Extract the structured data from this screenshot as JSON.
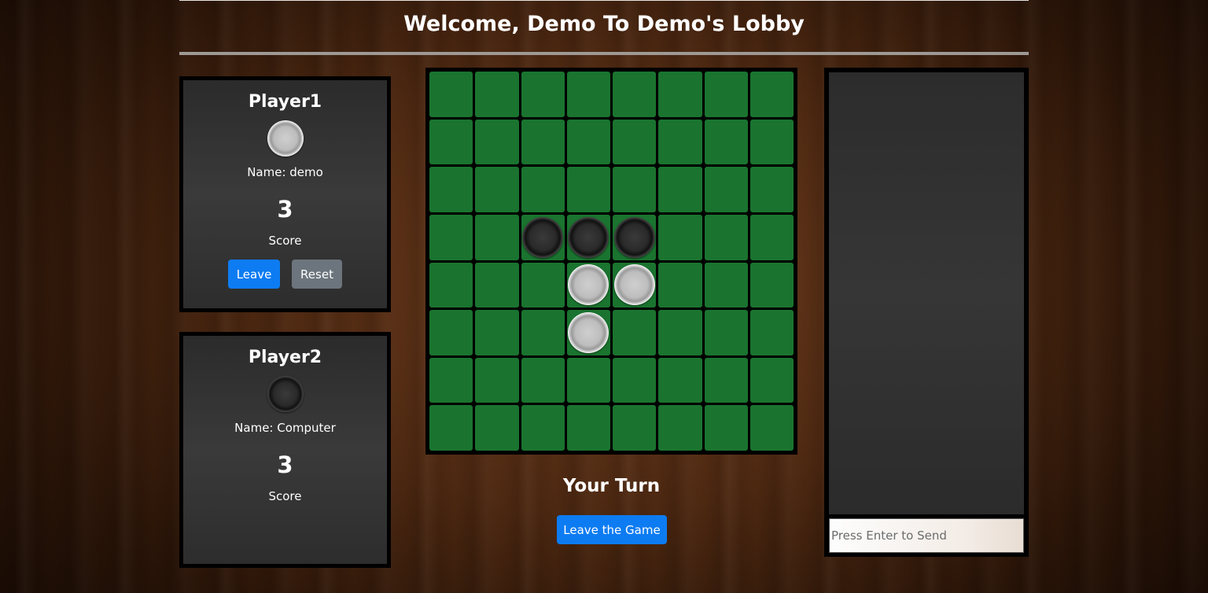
{
  "header": {
    "title": "Welcome, Demo To Demo's Lobby"
  },
  "players": [
    {
      "title": "Player1",
      "disc_color": "white",
      "name": "Name: demo",
      "score": "3",
      "score_label": "Score",
      "buttons": {
        "leave": "Leave",
        "reset": "Reset"
      }
    },
    {
      "title": "Player2",
      "disc_color": "black",
      "name": "Name: Computer",
      "score": "3",
      "score_label": "Score"
    }
  ],
  "board": {
    "size": 8,
    "cell_color": "#1a742f",
    "rows": [
      [
        ".",
        ".",
        ".",
        ".",
        ".",
        ".",
        ".",
        "."
      ],
      [
        ".",
        ".",
        ".",
        ".",
        ".",
        ".",
        ".",
        "."
      ],
      [
        ".",
        ".",
        ".",
        ".",
        ".",
        ".",
        ".",
        "."
      ],
      [
        ".",
        ".",
        "B",
        "B",
        "B",
        ".",
        ".",
        "."
      ],
      [
        ".",
        ".",
        ".",
        "W",
        "W",
        ".",
        ".",
        "."
      ],
      [
        ".",
        ".",
        ".",
        "W",
        ".",
        ".",
        ".",
        "."
      ],
      [
        ".",
        ".",
        ".",
        ".",
        ".",
        ".",
        ".",
        "."
      ],
      [
        ".",
        ".",
        ".",
        ".",
        ".",
        ".",
        ".",
        "."
      ]
    ]
  },
  "status": {
    "turn_text": "Your Turn",
    "leave_game_label": "Leave the Game"
  },
  "chat": {
    "placeholder": "Press Enter to Send",
    "value": ""
  },
  "colors": {
    "primary_button": "#0d7cf2",
    "secondary_button": "#6c757d"
  }
}
